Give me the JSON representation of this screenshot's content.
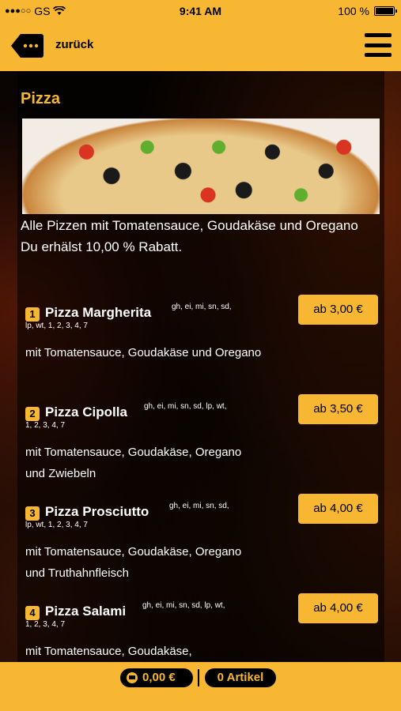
{
  "status_bar": {
    "signal": "●●●○○",
    "carrier": "GS",
    "time": "9:41 AM",
    "battery": "100 %"
  },
  "nav": {
    "back_label": "zurück"
  },
  "category": {
    "title": "Pizza",
    "intro_line1": "Alle Pizzen mit Tomatensauce, Goudakäse und Oregano",
    "intro_line2": "Du erhälst 10,00 % Rabatt."
  },
  "items": [
    {
      "number": "1",
      "name": "Pizza Margherita",
      "allergens_line1": "gh, ei, mi, sn, sd,",
      "allergens_line2": "lp, wt, 1, 2, 3, 4, 7",
      "price": "ab 3,00 €",
      "description": "mit Tomatensauce, Goudakäse und Oregano"
    },
    {
      "number": "2",
      "name": "Pizza Cipolla",
      "allergens_line1": "gh, ei, mi, sn, sd, lp, wt,",
      "allergens_line2": "1, 2, 3, 4, 7",
      "price": "ab 3,50 €",
      "description": "mit Tomatensauce, Goudakäse, Oregano und Zwiebeln"
    },
    {
      "number": "3",
      "name": "Pizza Prosciutto",
      "allergens_line1": "gh, ei, mi, sn, sd,",
      "allergens_line2": "lp, wt, 1, 2, 3, 4, 7",
      "price": "ab 4,00 €",
      "description": "mit Tomatensauce, Goudakäse, Oregano und Truthahnfleisch"
    },
    {
      "number": "4",
      "name": "Pizza Salami",
      "allergens_line1": "gh, ei, mi, sn, sd, lp, wt,",
      "allergens_line2": "1, 2, 3, 4, 7",
      "price": "ab 4,00 €",
      "description": "mit Tomatensauce, Goudakäse,"
    }
  ],
  "cart": {
    "total": "0,00 €",
    "count": "0 Artikel"
  },
  "colors": {
    "accent": "#f7b733",
    "background": "#000000"
  }
}
